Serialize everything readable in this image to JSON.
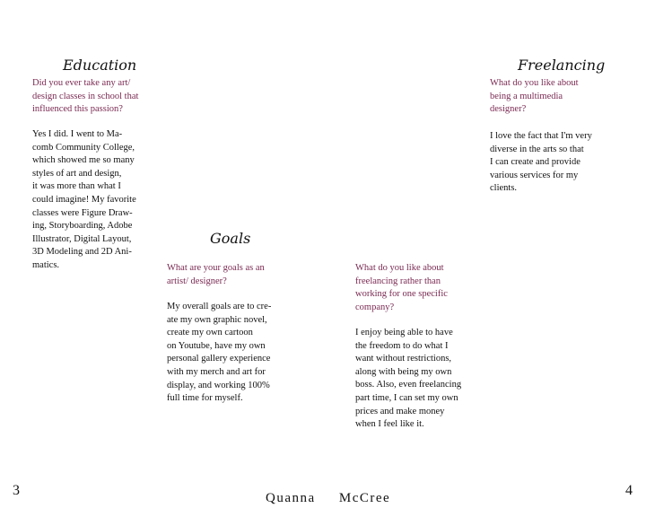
{
  "education": {
    "heading": "Education",
    "question": [
      "Did you ever take any art/",
      "design classes in school that",
      "influenced this passion?"
    ],
    "answer": [
      "Yes I did. I went to Ma-",
      "comb Community College,",
      "which showed me so many",
      "styles of  art and design,",
      "it was more than what I",
      "could imagine! My favorite",
      "classes were Figure Draw-",
      "ing, Storyboarding, Adobe",
      "Illustrator, Digital Layout,",
      "3D Modeling and 2D Ani-",
      "matics."
    ]
  },
  "goals": {
    "heading": "Goals",
    "question": [
      "What are your goals as an",
      "artist/ designer?"
    ],
    "answer": [
      "My overall goals are to cre-",
      "ate my own graphic  novel,",
      "create my own cartoon",
      "on Youtube, have my own",
      "personal gallery experience",
      "with my merch and art for",
      "display, and working 100%",
      "full time for myself."
    ]
  },
  "middle": {
    "question": [
      "What do you like about",
      "freelancing rather than",
      "working for one specific",
      "company?"
    ],
    "answer": [
      "I enjoy being able to have",
      "the freedom to do what I",
      "want without restrictions,",
      "along with being my own",
      "boss. Also, even freelancing",
      "part time, I can set my own",
      "prices and make money",
      "when I feel like it."
    ]
  },
  "freelancing": {
    "heading": "Freelancing",
    "question": [
      "What do you like about",
      "being a multimedia",
      "designer?"
    ],
    "answer": [
      "I love the fact that I'm very",
      "diverse in the arts so that",
      "I can create and provide",
      "various services for my",
      "clients."
    ]
  },
  "footer": {
    "page_left": "3",
    "name": "Quanna     McCree",
    "page_right": "4"
  },
  "colors": {
    "question": "#7a2a52",
    "text": "#111111"
  }
}
